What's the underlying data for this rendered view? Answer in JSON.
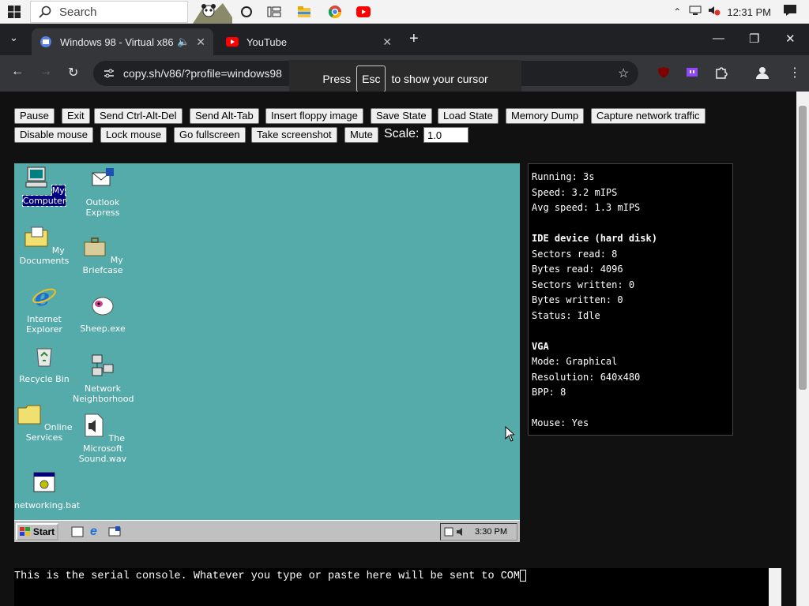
{
  "os_taskbar": {
    "search_placeholder": "Search",
    "clock": "12:31 PM"
  },
  "browser": {
    "tabs": [
      {
        "title": "Windows 98 - Virtual x86"
      },
      {
        "title": "YouTube"
      }
    ],
    "url": "copy.sh/v86/?profile=windows98",
    "esc_hint": {
      "before": "Press",
      "key": "Esc",
      "after": "to show your cursor"
    }
  },
  "controls": {
    "buttons": [
      "Pause",
      "Exit",
      "Send Ctrl-Alt-Del",
      "Send Alt-Tab",
      "Insert floppy image",
      "Save State",
      "Load State",
      "Memory Dump",
      "Capture network traffic",
      "Disable mouse",
      "Lock mouse",
      "Go fullscreen",
      "Take screenshot",
      "Mute"
    ],
    "scale_label": "Scale:",
    "scale_value": "1.0"
  },
  "vm": {
    "icons": [
      {
        "label": "My Computer",
        "icon": "computer-icon"
      },
      {
        "label": "Outlook Express",
        "icon": "outlook-icon"
      },
      {
        "label": "My Documents",
        "icon": "folder-docs-icon"
      },
      {
        "label": "My Briefcase",
        "icon": "briefcase-icon"
      },
      {
        "label": "Internet Explorer",
        "icon": "ie-icon"
      },
      {
        "label": "Sheep.exe",
        "icon": "sheep-icon"
      },
      {
        "label": "Recycle Bin",
        "icon": "recycle-bin-icon"
      },
      {
        "label": "Network Neighborhood",
        "icon": "network-icon"
      },
      {
        "label": "Online Services",
        "icon": "folder-icon"
      },
      {
        "label": "The Microsoft Sound.wav",
        "icon": "sound-file-icon"
      },
      {
        "label": "networking.bat",
        "icon": "bat-file-icon"
      }
    ],
    "start_label": "Start",
    "clock": "3:30 PM"
  },
  "stats": {
    "running": "Running: 3s",
    "speed": "Speed: 3.2 mIPS",
    "avg_speed": "Avg speed: 1.3 mIPS",
    "ide_header": "IDE device (hard disk)",
    "sectors_read": "Sectors read: 8",
    "bytes_read": "Bytes read: 4096",
    "sectors_written": "Sectors written: 0",
    "bytes_written": "Bytes written: 0",
    "status": "Status: Idle",
    "vga_header": "VGA",
    "mode": "Mode: Graphical",
    "resolution": "Resolution: 640x480",
    "bpp": "BPP: 8",
    "mouse": "Mouse: Yes"
  },
  "serial_console": "This is the serial console. Whatever you type or paste here will be sent to COM",
  "colors": {
    "vm_desktop": "#55aaaa",
    "chrome_dark": "#202124",
    "win98_gray": "#c0c0c0"
  }
}
